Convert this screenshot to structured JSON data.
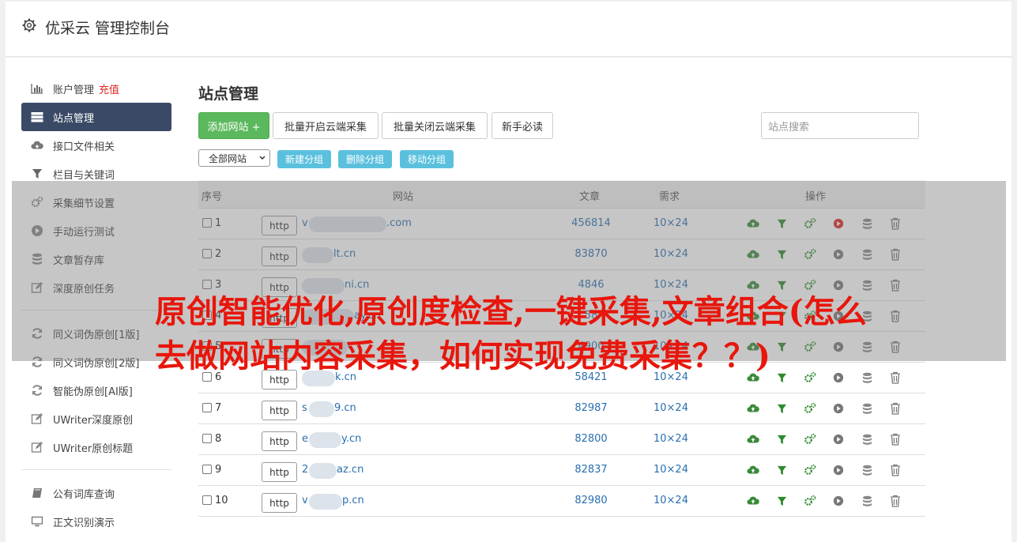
{
  "header": {
    "title": "优采云 管理控制台"
  },
  "sidebar": {
    "items": [
      {
        "label": "账户管理",
        "extra": "充值",
        "icon": "bar-chart-icon"
      },
      {
        "label": "站点管理",
        "icon": "server-icon",
        "active": true
      },
      {
        "label": "接口文件相关",
        "icon": "cloud-upload-icon"
      },
      {
        "label": "栏目与关键词",
        "icon": "filter-icon"
      },
      {
        "label": "采集细节设置",
        "icon": "gears-icon"
      },
      {
        "label": "手动运行测试",
        "icon": "play-icon"
      },
      {
        "label": "文章暂存库",
        "icon": "database-icon"
      },
      {
        "label": "深度原创任务",
        "icon": "edit-icon"
      }
    ],
    "items2": [
      {
        "label": "同义词伪原创[1版]",
        "icon": "refresh-icon"
      },
      {
        "label": "同义词伪原创[2版]",
        "icon": "refresh-icon"
      },
      {
        "label": "智能伪原创[AI版]",
        "icon": "refresh-icon"
      },
      {
        "label": "UWriter深度原创",
        "icon": "edit-icon"
      },
      {
        "label": "UWriter原创标题",
        "icon": "edit-icon"
      }
    ],
    "items3": [
      {
        "label": "公有词库查询",
        "icon": "book-icon"
      },
      {
        "label": "正文识别演示",
        "icon": "monitor-icon"
      }
    ]
  },
  "main": {
    "title": "站点管理",
    "buttons": {
      "add": "添加网站 +",
      "batch_open": "批量开启云端采集",
      "batch_close": "批量关闭云端采集",
      "guide": "新手必读"
    },
    "search_placeholder": "站点搜索",
    "group_select": "全部网站",
    "group_buttons": {
      "new": "新建分组",
      "delete": "删除分组",
      "move": "移动分组"
    }
  },
  "table": {
    "headers": {
      "index": "序号",
      "site": "网站",
      "articles": "文章",
      "demand": "需求",
      "ops": "操作"
    },
    "rows": [
      {
        "num": "1",
        "http": "http",
        "prefix": "v",
        "suffix": ".com",
        "count": "456814",
        "need": "10×24",
        "active": true
      },
      {
        "num": "2",
        "http": "http",
        "prefix": "",
        "suffix": "lt.cn",
        "count": "83870",
        "need": "10×24",
        "active": false
      },
      {
        "num": "3",
        "http": "http",
        "prefix": "",
        "suffix": "ni.cn",
        "count": "4846",
        "need": "10×24",
        "active": false
      },
      {
        "num": "4",
        "http": "http",
        "prefix": "",
        "suffix": "ay.cn",
        "count": "58",
        "need": "10×24",
        "active": false
      },
      {
        "num": "5",
        "http": "http",
        "prefix": "",
        "suffix": "c",
        "count": "4900",
        "need": "10×24",
        "active": false
      },
      {
        "num": "6",
        "http": "http",
        "prefix": "",
        "suffix": "k.cn",
        "count": "58421",
        "need": "10×24",
        "active": false
      },
      {
        "num": "7",
        "http": "http",
        "prefix": "s",
        "suffix": "9.cn",
        "count": "82987",
        "need": "10×24",
        "active": false
      },
      {
        "num": "8",
        "http": "http",
        "prefix": "e",
        "suffix": "y.cn",
        "count": "82800",
        "need": "10×24",
        "active": false
      },
      {
        "num": "9",
        "http": "http",
        "prefix": "2",
        "suffix": "az.cn",
        "count": "82837",
        "need": "10×24",
        "active": false
      },
      {
        "num": "10",
        "http": "http",
        "prefix": "v",
        "suffix": "p.cn",
        "count": "82980",
        "need": "10×24",
        "active": false
      }
    ]
  },
  "overlay_text": "原创智能优化,原创度检查,一键采集,文章组合(怎么去做网站内容采集，如何实现免费采集？？)",
  "colors": {
    "active_nav": "#3a4a66",
    "green": "#5cb85c",
    "info": "#5bc0de",
    "overlay_red": "#e8160c"
  }
}
